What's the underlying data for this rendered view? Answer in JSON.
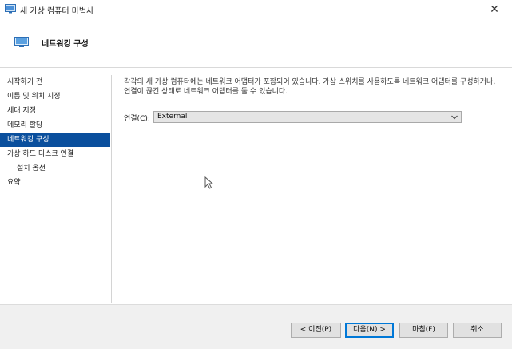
{
  "window": {
    "title": "새 가상 컴퓨터 마법사",
    "icon": "virtual-machine-icon",
    "close_glyph": "✕"
  },
  "header": {
    "title": "네트워킹 구성",
    "icon": "virtual-machine-icon"
  },
  "sidebar": {
    "items": [
      {
        "label": "시작하기 전",
        "active": false
      },
      {
        "label": "이름 및 위치 지정",
        "active": false
      },
      {
        "label": "세대 지정",
        "active": false
      },
      {
        "label": "메모리 할당",
        "active": false
      },
      {
        "label": "네트워킹 구성",
        "active": true
      },
      {
        "label": "가상 하드 디스크 연결",
        "active": false
      },
      {
        "label": "설치 옵션",
        "active": false
      },
      {
        "label": "요약",
        "active": false
      }
    ]
  },
  "main": {
    "description": "각각의 새 가상 컴퓨터에는 네트워크 어댑터가 포함되어 있습니다. 가상 스위치를 사용하도록 네트워크 어댑터를 구성하거나, 연결이 끊긴 상태로 네트워크 어댑터를 둘 수 있습니다.",
    "connection_label": "연결(C):",
    "connection_value": "External"
  },
  "footer": {
    "prev_label": "< 이전(P)",
    "next_label": "다음(N) >",
    "finish_label": "마침(F)",
    "cancel_label": "취소"
  },
  "colors": {
    "active_nav_bg": "#0a4f9d",
    "footer_bg": "#f0f0f0",
    "primary_button_border": "#0078d7"
  }
}
